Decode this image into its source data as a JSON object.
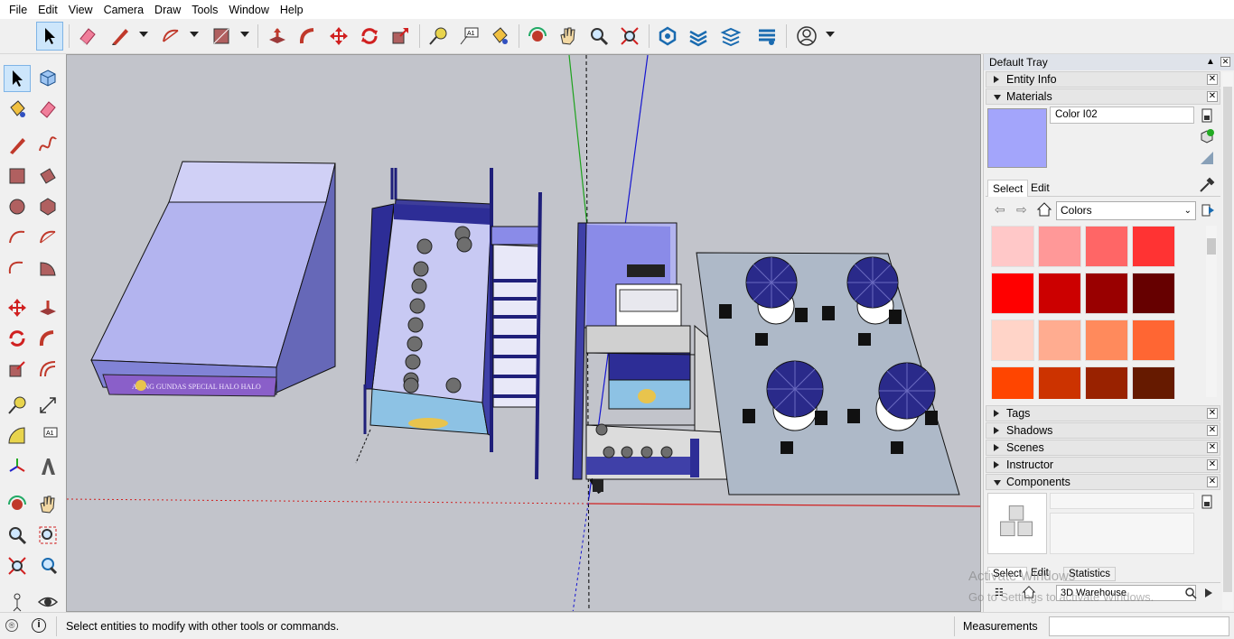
{
  "menu": [
    "File",
    "Edit",
    "View",
    "Camera",
    "Draw",
    "Tools",
    "Window",
    "Help"
  ],
  "tray": {
    "title": "Default Tray",
    "panels": {
      "entity_info": "Entity Info",
      "materials": "Materials",
      "tags": "Tags",
      "shadows": "Shadows",
      "scenes": "Scenes",
      "instructor": "Instructor",
      "components": "Components"
    },
    "material_name": "Color I02",
    "material_color": "#a3a5fb",
    "tab_select": "Select",
    "tab_edit": "Edit",
    "library": "Colors",
    "swatches": [
      "#ffc8c8",
      "#ff9898",
      "#ff6666",
      "#ff3333",
      "#ff0000",
      "#cc0000",
      "#990000",
      "#660000",
      "#ffd4c8",
      "#ffac90",
      "#ff8a5c",
      "#ff6633",
      "#ff4500",
      "#cc3300",
      "#992200",
      "#661a00"
    ],
    "components_tabs": [
      "Select",
      "Edit",
      "Statistics"
    ],
    "components_search": "3D Warehouse"
  },
  "status": {
    "message": "Select entities to modify with other tools or commands.",
    "measurements_label": "Measurements"
  },
  "watermark": {
    "line1": "Activate Windows",
    "line2": "Go to Settings to activate Windows."
  },
  "scene": {
    "sign_text": "ALING GUNDAS SPECIAL HALO HALO"
  }
}
